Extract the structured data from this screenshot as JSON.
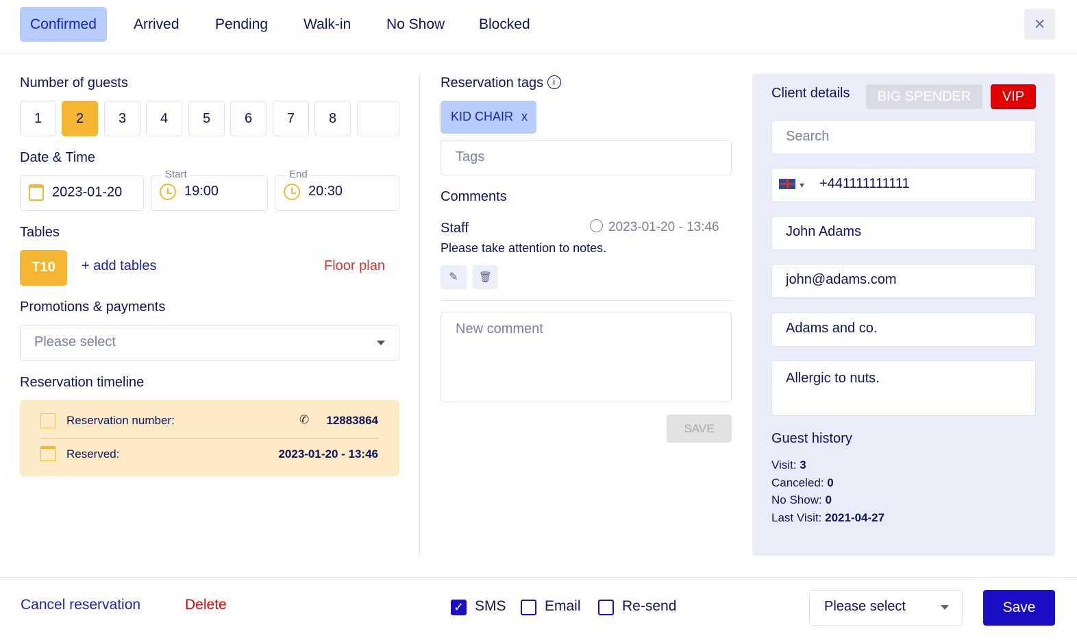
{
  "tabs": [
    "Confirmed",
    "Arrived",
    "Pending",
    "Walk-in",
    "No Show",
    "Blocked"
  ],
  "close_icon": "×",
  "guests": {
    "label": "Number of guests",
    "options": [
      "1",
      "2",
      "3",
      "4",
      "5",
      "6",
      "7",
      "8",
      ""
    ],
    "selected": "2"
  },
  "datetime": {
    "label": "Date & Time",
    "date": "2023-01-20",
    "start_label": "Start",
    "start": "19:00",
    "end_label": "End",
    "end": "20:30"
  },
  "tables": {
    "label": "Tables",
    "table": "T10",
    "add": "+ add tables",
    "floor_plan": "Floor plan"
  },
  "promotions": {
    "label": "Promotions & payments",
    "placeholder": "Please select"
  },
  "timeline": {
    "label": "Reservation timeline",
    "number_label": "Reservation number:",
    "number": "12883864",
    "reserved_label": "Reserved:",
    "reserved": "2023-01-20 - 13:46"
  },
  "tags": {
    "label": "Reservation tags",
    "chip": "KID CHAIR",
    "chip_remove": "x",
    "placeholder": "Tags"
  },
  "comments": {
    "label": "Comments",
    "author": "Staff",
    "time": "2023-01-20 - 13:46",
    "text": "Please take attention to notes.",
    "new_placeholder": "New comment",
    "save": "SAVE"
  },
  "client": {
    "label": "Client details",
    "badge1": "BIG SPENDER",
    "badge2": "VIP",
    "search_placeholder": "Search",
    "phone": "+441111111111",
    "name": "John Adams",
    "email": "john@adams.com",
    "company": "Adams and co.",
    "notes": "Allergic to nuts."
  },
  "history": {
    "label": "Guest history",
    "visit_label": "Visit:",
    "visit": "3",
    "canceled_label": "Canceled:",
    "canceled": "0",
    "noshow_label": "No Show:",
    "noshow": "0",
    "last_label": "Last Visit:",
    "last": "2021-04-27"
  },
  "footer": {
    "cancel": "Cancel reservation",
    "delete": "Delete",
    "sms": "SMS",
    "email": "Email",
    "resend": "Re-send",
    "select": "Please select",
    "save": "Save"
  },
  "colors": {
    "accent": "#1a0fc7",
    "orange": "#f5b731",
    "red": "#e00000",
    "navy": "#10145e"
  }
}
